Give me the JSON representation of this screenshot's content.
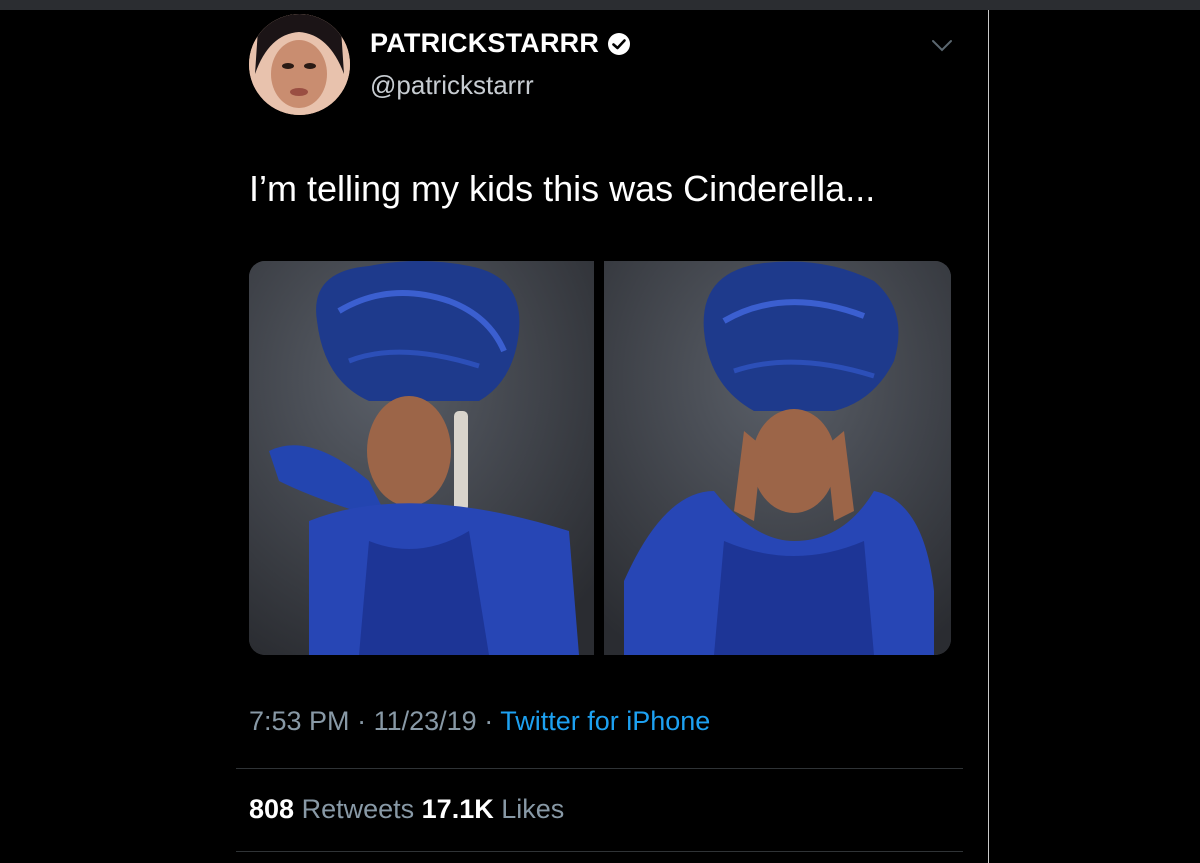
{
  "tweet": {
    "display_name": "PATRICKSTARRR",
    "handle": "@patrickstarrr",
    "verified_icon": "verified-badge-icon",
    "menu_icon": "chevron-down-icon",
    "text": "I’m telling my kids this was Cinderella...",
    "media": [
      {
        "alt": "photo-1"
      },
      {
        "alt": "photo-2"
      }
    ],
    "time": "7:53 PM",
    "dot": "·",
    "date": "11/23/19",
    "source": "Twitter for iPhone",
    "retweets_count": "808",
    "retweets_label": "Retweets",
    "likes_count": "17.1K",
    "likes_label": "Likes"
  },
  "colors": {
    "background": "#000000",
    "text_primary": "#ffffff",
    "text_secondary": "#8899a6",
    "link": "#1da1f2",
    "dress_blue": "#1f3fa8"
  }
}
